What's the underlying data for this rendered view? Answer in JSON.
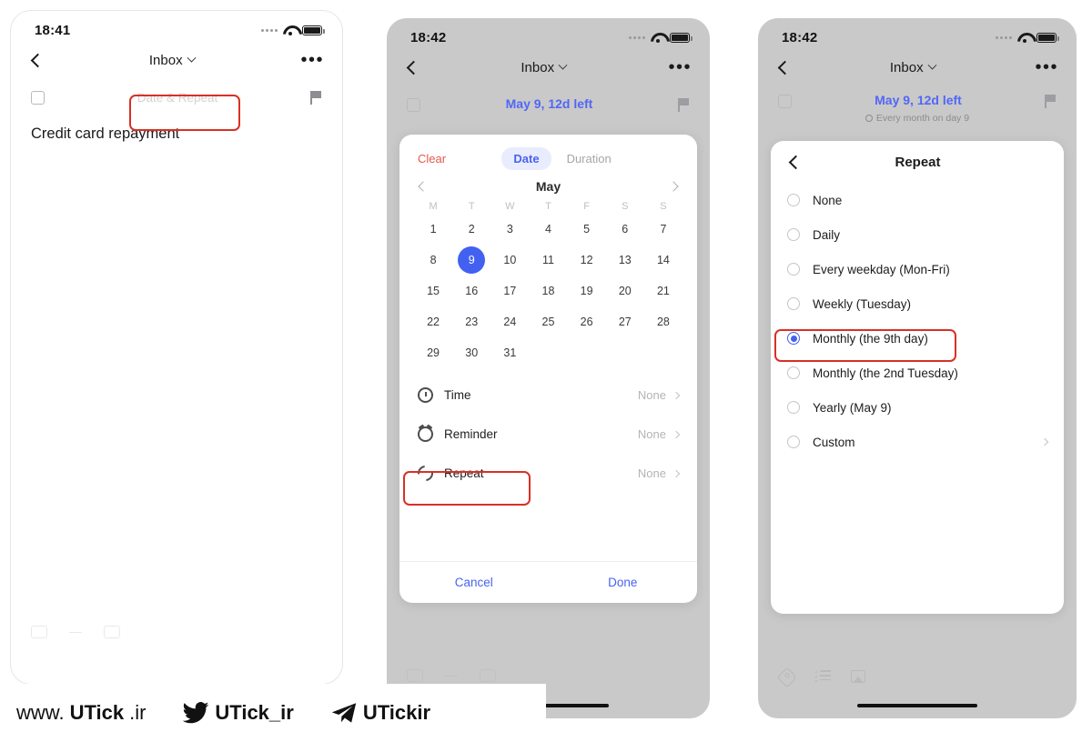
{
  "panels": [
    {
      "id": "panel-task-detail",
      "status": {
        "time": "18:41"
      },
      "nav": {
        "title": "Inbox",
        "more": "•••"
      },
      "task": {
        "date_placeholder": "Date & Repeat",
        "title": "Credit card repayment"
      }
    },
    {
      "id": "panel-date-picker",
      "status": {
        "time": "18:42"
      },
      "nav": {
        "title": "Inbox",
        "more": "•••"
      },
      "task": {
        "due": "May 9, 12d left"
      },
      "picker": {
        "clear": "Clear",
        "tabs": [
          {
            "label": "Date",
            "active": true
          },
          {
            "label": "Duration",
            "active": false
          }
        ],
        "month": "May",
        "dow": [
          "M",
          "T",
          "W",
          "T",
          "F",
          "S",
          "S"
        ],
        "days": [
          1,
          2,
          3,
          4,
          5,
          6,
          7,
          8,
          9,
          10,
          11,
          12,
          13,
          14,
          15,
          16,
          17,
          18,
          19,
          20,
          21,
          22,
          23,
          24,
          25,
          26,
          27,
          28,
          29,
          30,
          31
        ],
        "selected_day": 9,
        "options": [
          {
            "icon": "clock-icon",
            "label": "Time",
            "value": "None"
          },
          {
            "icon": "alarm-icon",
            "label": "Reminder",
            "value": "None"
          },
          {
            "icon": "repeat-icon",
            "label": "Repeat",
            "value": "None"
          }
        ],
        "cancel": "Cancel",
        "done": "Done"
      }
    },
    {
      "id": "panel-repeat-options",
      "status": {
        "time": "18:42"
      },
      "nav": {
        "title": "Inbox",
        "more": "•••"
      },
      "task": {
        "due": "May 9, 12d left",
        "repeat_summary": "Every month on day 9"
      },
      "repeat": {
        "title": "Repeat",
        "options": [
          {
            "label": "None",
            "selected": false,
            "chevron": false
          },
          {
            "label": "Daily",
            "selected": false,
            "chevron": false
          },
          {
            "label": "Every weekday (Mon-Fri)",
            "selected": false,
            "chevron": false
          },
          {
            "label": "Weekly (Tuesday)",
            "selected": false,
            "chevron": false
          },
          {
            "label": "Monthly (the 9th day)",
            "selected": true,
            "chevron": false
          },
          {
            "label": "Monthly (the 2nd Tuesday)",
            "selected": false,
            "chevron": false
          },
          {
            "label": "Yearly (May 9)",
            "selected": false,
            "chevron": false
          },
          {
            "label": "Custom",
            "selected": false,
            "chevron": true
          }
        ]
      }
    }
  ],
  "toolbar_icons": [
    "tag-icon",
    "list-icon",
    "image-icon"
  ],
  "watermark": [
    {
      "icon": "none",
      "light": "www.",
      "bold": "UTick",
      "tail": ".ir"
    },
    {
      "icon": "twitter-icon",
      "light": "",
      "bold": "UTick_ir",
      "tail": ""
    },
    {
      "icon": "telegram-icon",
      "light": "",
      "bold": "UTickir",
      "tail": ""
    }
  ],
  "colors": {
    "accent_blue": "#4361f0",
    "annotation_red": "#d93025",
    "clear_red": "#e8584c",
    "backdrop_gray": "#c9c9c9"
  }
}
